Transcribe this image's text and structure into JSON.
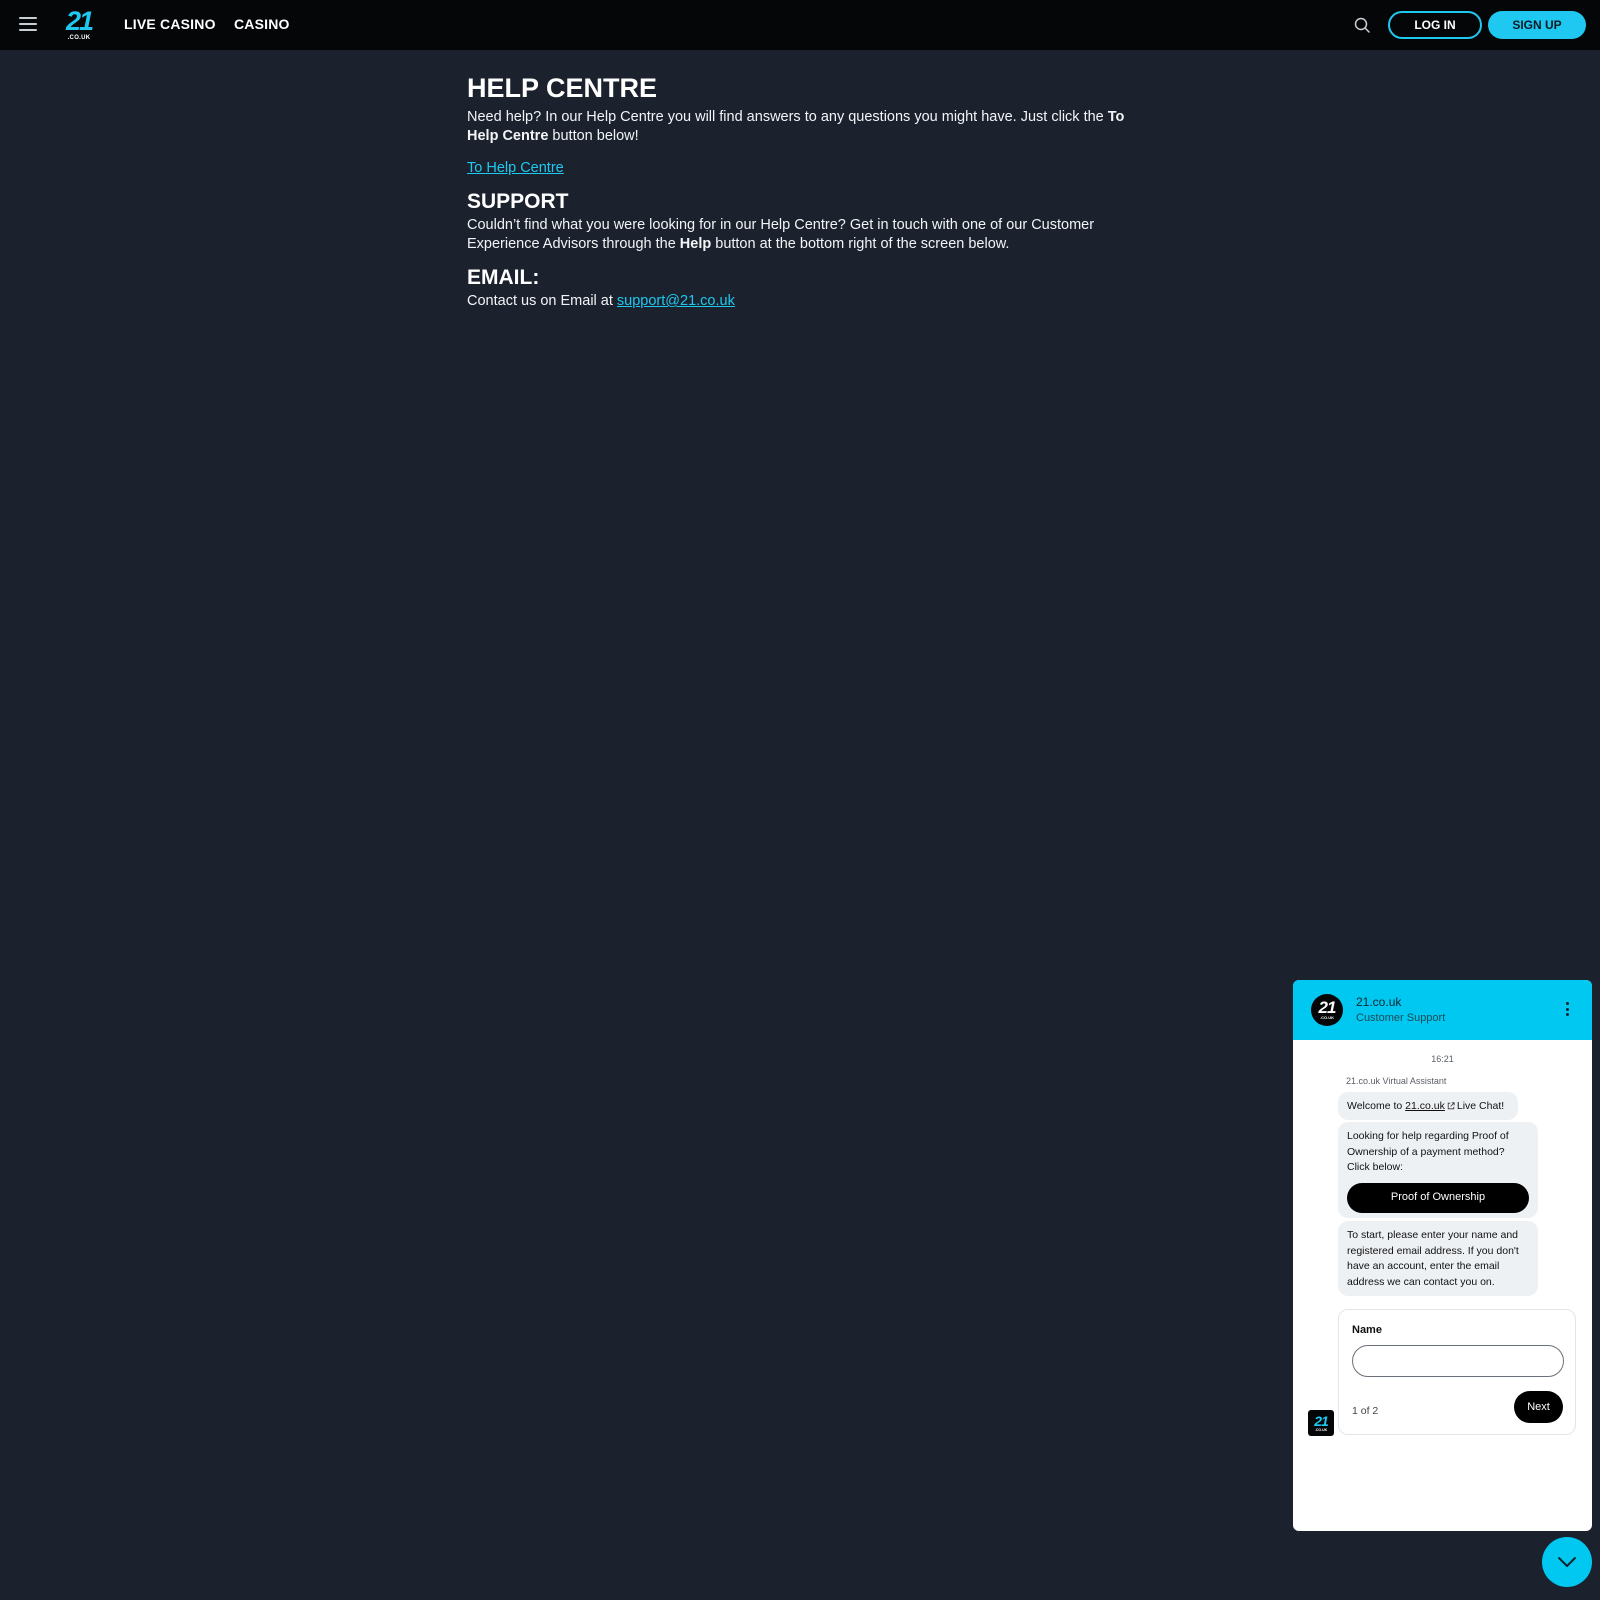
{
  "header": {
    "menu_icon": "hamburger-menu-icon",
    "logo": {
      "number": "21",
      "domain": ".CO.UK"
    },
    "nav": [
      {
        "label": "LIVE CASINO"
      },
      {
        "label": "CASINO"
      }
    ],
    "search_icon": "search-icon",
    "login_label": "LOG IN",
    "signup_label": "SIGN UP"
  },
  "main": {
    "help_title": "HELP CENTRE",
    "help_text_1": "Need help? In our Help Centre you will find answers to any questions you might have. Just click the",
    "help_text_bold": "To Help Centre",
    "help_text_2": "button below!",
    "help_link": "To Help Centre",
    "support_title": "SUPPORT",
    "support_text_1": "Couldn’t find what you were looking for in our Help Centre? Get in touch with one of our Customer Experience Advisors through the",
    "support_text_bold": "Help",
    "support_text_2": "button at the bottom right of the screen below.",
    "email_title": "EMAIL:",
    "email_text": "Contact us on Email at",
    "email_link": "support@21.co.uk"
  },
  "chat": {
    "title": "21.co.uk",
    "subtitle": "Customer Support",
    "avatar": {
      "number": "21",
      "domain": ".CO.UK"
    },
    "time": "16:21",
    "sender": "21.co.uk Virtual Assistant",
    "welcome_prefix": "Welcome to",
    "welcome_link": "21.co.uk",
    "welcome_suffix": "Live Chat!",
    "proof_text": "Looking for help regarding Proof of Ownership of a payment method? Click below:",
    "proof_button": "Proof of Ownership",
    "start_text": "To start, please enter your name and registered email address. If you don't have an account, enter the email address we can contact you on.",
    "form": {
      "label": "Name",
      "value": "",
      "step": "1 of 2",
      "next_label": "Next"
    }
  },
  "colors": {
    "accent": "#1fc8f0",
    "chat_header": "#00c8f0",
    "page_bg": "#1b222d",
    "topbar_bg": "#050608"
  }
}
